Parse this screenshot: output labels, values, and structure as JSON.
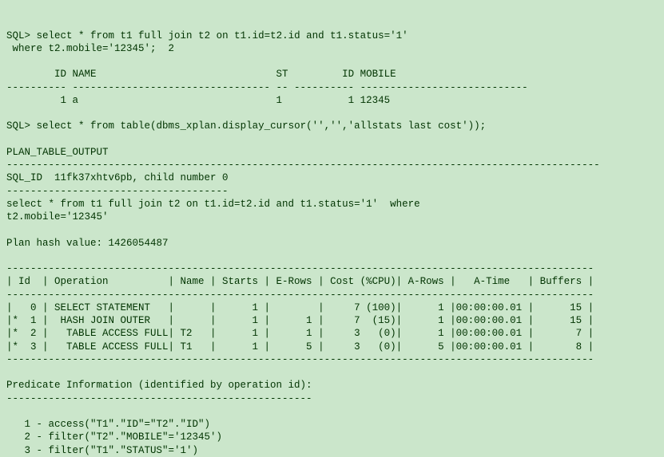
{
  "sql1_prompt": "SQL>",
  "sql1_stmt_line1": "select * from t1 full join t2 on t1.id=t2.id and t1.status='1'",
  "sql1_stmt_line2": "where t2.mobile='12345';  2",
  "result_header": "        ID NAME                              ST         ID MOBILE",
  "result_divider": "---------- --------------------------------- -- ---------- ----------------------------",
  "result_row": "         1 a                                 1           1 12345",
  "sql2_prompt": "SQL>",
  "sql2_stmt": "select * from table(dbms_xplan.display_cursor('','','allstats last cost'));",
  "plan_header": "PLAN_TABLE_OUTPUT",
  "long_divider": "---------------------------------------------------------------------------------------------------",
  "sqlid_line": "SQL_ID  11fk37xhtv6pb, child number 0",
  "sqlid_divider": "-------------------------------------",
  "stmt_echo_line1": "select * from t1 full join t2 on t1.id=t2.id and t1.status='1'  where",
  "stmt_echo_line2": "t2.mobile='12345'",
  "plan_hash": "Plan hash value: 1426054487",
  "plan_tbl_divider": "--------------------------------------------------------------------------------------------------",
  "plan_tbl_header": "| Id  | Operation          | Name | Starts | E-Rows | Cost (%CPU)| A-Rows |   A-Time   | Buffers |",
  "plan_row0": "|   0 | SELECT STATEMENT   |      |      1 |        |     7 (100)|      1 |00:00:00.01 |      15 |",
  "plan_row1": "|*  1 |  HASH JOIN OUTER   |      |      1 |      1 |     7  (15)|      1 |00:00:00.01 |      15 |",
  "plan_row2": "|*  2 |   TABLE ACCESS FULL| T2   |      1 |      1 |     3   (0)|      1 |00:00:00.01 |       7 |",
  "plan_row3": "|*  3 |   TABLE ACCESS FULL| T1   |      1 |      5 |     3   (0)|      5 |00:00:00.01 |       8 |",
  "predicate_header": "Predicate Information (identified by operation id):",
  "predicate_divider": "---------------------------------------------------",
  "predicate1": "   1 - access(\"T1\".\"ID\"=\"T2\".\"ID\")",
  "predicate2": "   2 - filter(\"T2\".\"MOBILE\"='12345')",
  "predicate3": "   3 - filter(\"T1\".\"STATUS\"='1')",
  "chart_data": {
    "type": "table",
    "sql_id": "11fk37xhtv6pb",
    "child_number": 0,
    "plan_hash_value": 1426054487,
    "columns": [
      "Id",
      "predicate_flag",
      "Operation",
      "Name",
      "Starts",
      "E-Rows",
      "Cost",
      "%CPU",
      "A-Rows",
      "A-Time",
      "Buffers"
    ],
    "rows": [
      [
        0,
        "",
        "SELECT STATEMENT",
        "",
        1,
        null,
        7,
        100,
        1,
        "00:00:00.01",
        15
      ],
      [
        1,
        "*",
        "HASH JOIN OUTER",
        "",
        1,
        1,
        7,
        15,
        1,
        "00:00:00.01",
        15
      ],
      [
        2,
        "*",
        "TABLE ACCESS FULL",
        "T2",
        1,
        1,
        3,
        0,
        1,
        "00:00:00.01",
        7
      ],
      [
        3,
        "*",
        "TABLE ACCESS FULL",
        "T1",
        1,
        5,
        3,
        0,
        5,
        "00:00:00.01",
        8
      ]
    ],
    "predicates": [
      {
        "id": 1,
        "type": "access",
        "expr": "\"T1\".\"ID\"=\"T2\".\"ID\""
      },
      {
        "id": 2,
        "type": "filter",
        "expr": "\"T2\".\"MOBILE\"='12345'"
      },
      {
        "id": 3,
        "type": "filter",
        "expr": "\"T1\".\"STATUS\"='1'"
      }
    ],
    "query_result": {
      "columns": [
        "ID",
        "NAME",
        "ST",
        "ID",
        "MOBILE"
      ],
      "rows": [
        [
          1,
          "a",
          "1",
          1,
          "12345"
        ]
      ]
    }
  }
}
